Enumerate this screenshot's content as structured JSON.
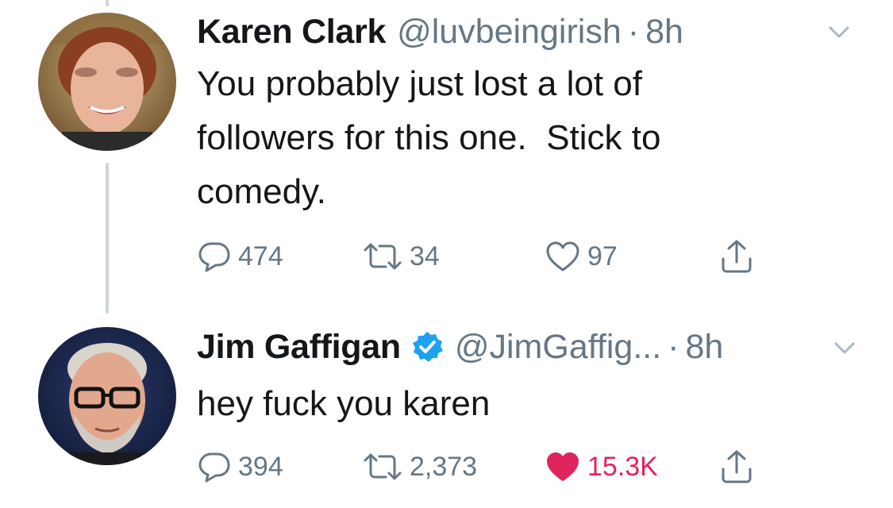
{
  "tweets": [
    {
      "display_name": "Karen Clark",
      "verified": false,
      "handle": "@luvbeingirish",
      "separator": "·",
      "timestamp": "8h",
      "text": "You probably just lost a lot of\nfollowers for this one.  Stick to\ncomedy.",
      "replies": "474",
      "retweets": "34",
      "likes": "97",
      "liked": false
    },
    {
      "display_name": "Jim Gaffigan",
      "verified": true,
      "handle": "@JimGaffig...",
      "separator": "·",
      "timestamp": "8h",
      "text": "hey fuck you karen",
      "replies": "394",
      "retweets": "2,373",
      "likes": "15.3K",
      "liked": true
    }
  ],
  "colors": {
    "text": "#14171a",
    "secondary": "#657786",
    "like_active": "#e0245e",
    "verified": "#1da1f2",
    "thread_line": "#ccd6dd"
  },
  "icons": {
    "reply": "reply-icon",
    "retweet": "retweet-icon",
    "like": "heart-icon",
    "share": "share-icon",
    "caret": "chevron-down-icon",
    "verified": "verified-badge-icon"
  }
}
